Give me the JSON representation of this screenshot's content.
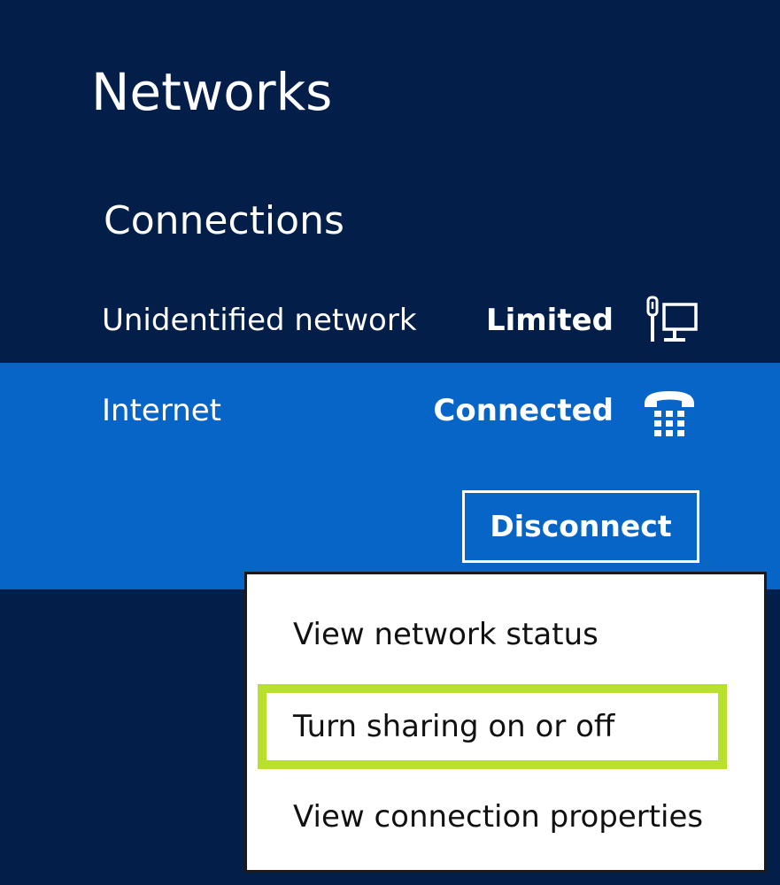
{
  "panel": {
    "title": "Networks",
    "section_title": "Connections"
  },
  "connections": [
    {
      "name": "Unidentified network",
      "status": "Limited",
      "icon": "ethernet-network-icon"
    },
    {
      "name": "Internet",
      "status": "Connected",
      "icon": "dialup-telephone-icon",
      "action_label": "Disconnect"
    }
  ],
  "context_menu": {
    "items": [
      {
        "label": "View network status"
      },
      {
        "label": "Turn sharing on or off",
        "highlighted": true,
        "highlight_color": "#b8e02c"
      },
      {
        "label": "View connection properties"
      }
    ]
  },
  "colors": {
    "background": "#041e4a",
    "selected_row": "#0665c6",
    "highlight": "#b8e02c"
  }
}
